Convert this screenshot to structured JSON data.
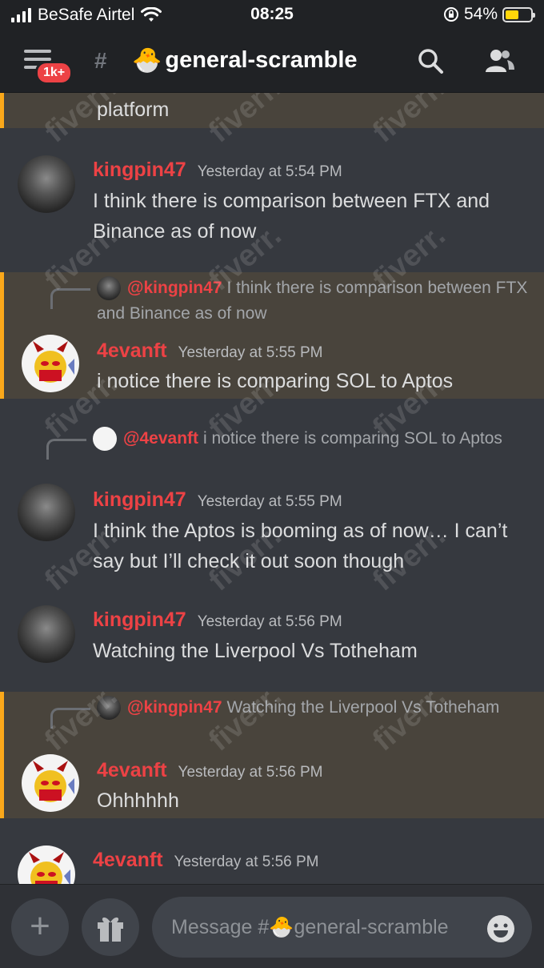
{
  "status_bar": {
    "carrier": "BeSafe Airtel",
    "time": "08:25",
    "battery": "54%",
    "battery_level": 0.54
  },
  "header": {
    "badge": "1k+",
    "channel_name": "general-scramble",
    "channel_emoji": "🐣"
  },
  "messages": [
    {
      "text": "platform"
    },
    {
      "author": "kingpin47",
      "timestamp": "Yesterday at 5:54 PM",
      "text": "I think there is comparison between FTX and Binance as of now"
    },
    {
      "reply_to": "@kingpin47",
      "reply_text": "I think there is comparison between FTX and Binance as of now",
      "author": "4evanft",
      "timestamp": "Yesterday at 5:55 PM",
      "text": "i notice there is comparing SOL to Aptos"
    },
    {
      "reply_to": "@4evanft",
      "reply_text": "i notice there is comparing SOL to Aptos",
      "author": "kingpin47",
      "timestamp": "Yesterday at 5:55 PM",
      "text": "I think the Aptos is booming as of now… I can’t say but I’ll check it out soon though"
    },
    {
      "author": "kingpin47",
      "timestamp": "Yesterday at 5:56 PM",
      "text": "Watching the Liverpool Vs Totheham"
    },
    {
      "reply_to": "@kingpin47",
      "reply_text": "Watching the Liverpool Vs Totheham",
      "author": "4evanft",
      "timestamp": "Yesterday at 5:56 PM",
      "text": "Ohhhhhh"
    },
    {
      "author": "4evanft",
      "timestamp": "Yesterday at 5:56 PM"
    }
  ],
  "composer": {
    "placeholder_prefix": "Message #",
    "placeholder_emoji": "🐣",
    "placeholder_channel": "general-scramble"
  },
  "watermark": "fiverr.",
  "colors": {
    "background": "#36393f",
    "header": "#202225",
    "username": "#ed4245",
    "mention_highlight": "#49443c",
    "mention_bar": "#faa81a"
  }
}
